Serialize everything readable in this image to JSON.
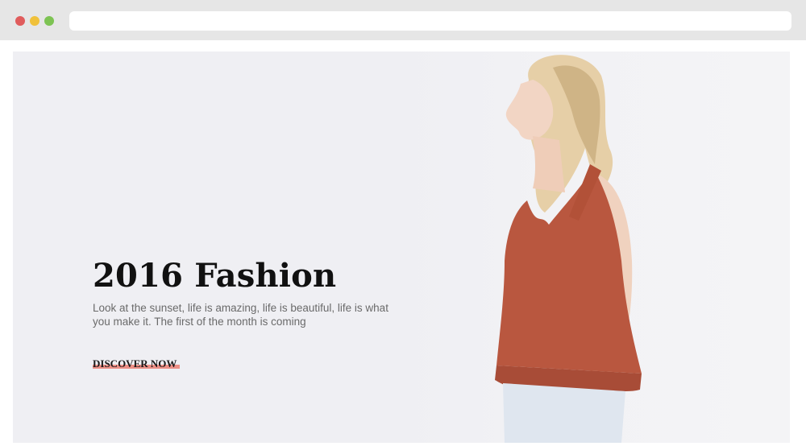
{
  "browser": {
    "dots": [
      "#e05c5c",
      "#f0c13b",
      "#7dc353"
    ]
  },
  "hero": {
    "title": "2016 Fashion",
    "text": "Look at the sunset, life is amazing, life is beautiful, life is what you make it. The first of the month is coming",
    "cta_label": "DISCOVER NOW"
  },
  "colors": {
    "background": "#efeff3",
    "accent": "#ec8f86",
    "top_color": "#b9573f"
  },
  "icons": {
    "image": "model-photo"
  }
}
